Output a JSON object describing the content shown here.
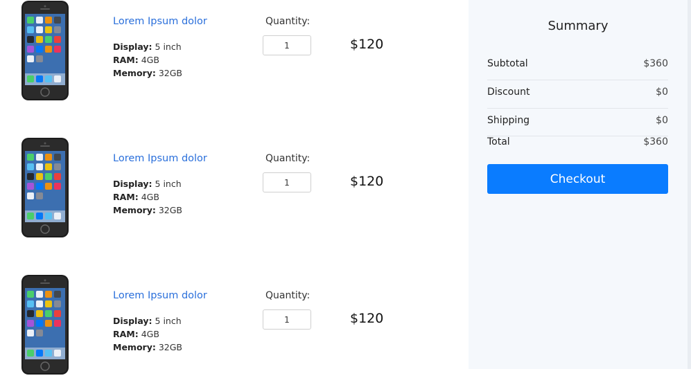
{
  "cart": {
    "items": [
      {
        "title": "Lorem Ipsum dolor",
        "display_label": "Display:",
        "display_value": "5 inch",
        "ram_label": "RAM:",
        "ram_value": "4GB",
        "memory_label": "Memory:",
        "memory_value": "32GB",
        "quantity_label": "Quantity:",
        "quantity": "1",
        "price": "$120"
      },
      {
        "title": "Lorem Ipsum dolor",
        "display_label": "Display:",
        "display_value": "5 inch",
        "ram_label": "RAM:",
        "ram_value": "4GB",
        "memory_label": "Memory:",
        "memory_value": "32GB",
        "quantity_label": "Quantity:",
        "quantity": "1",
        "price": "$120"
      },
      {
        "title": "Lorem Ipsum dolor",
        "display_label": "Display:",
        "display_value": "5 inch",
        "ram_label": "RAM:",
        "ram_value": "4GB",
        "memory_label": "Memory:",
        "memory_value": "32GB",
        "quantity_label": "Quantity:",
        "quantity": "1",
        "price": "$120"
      }
    ]
  },
  "summary": {
    "title": "Summary",
    "subtotal_label": "Subtotal",
    "subtotal_value": "$360",
    "discount_label": "Discount",
    "discount_value": "$0",
    "shipping_label": "Shipping",
    "shipping_value": "$0",
    "total_label": "Total",
    "total_value": "$360",
    "checkout_label": "Checkout"
  },
  "colors": {
    "link": "#2a6fdb",
    "checkout_bg": "#0a7cff",
    "summary_bg": "#f5f8fc"
  },
  "icons": {
    "product_image": "smartphone-icon"
  }
}
